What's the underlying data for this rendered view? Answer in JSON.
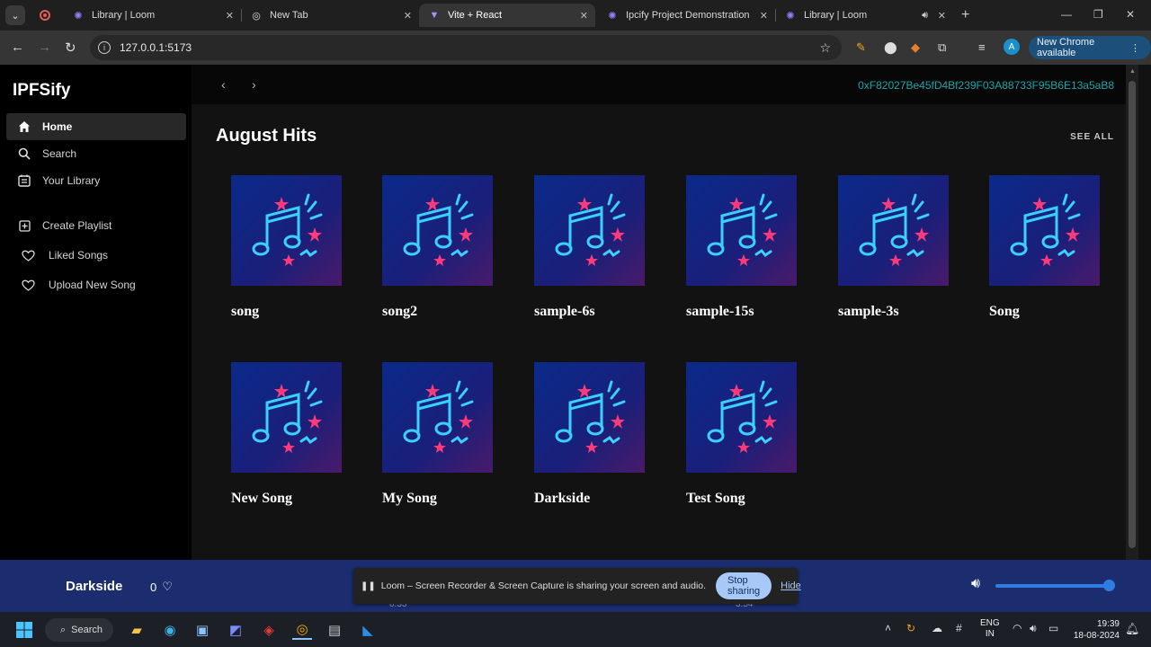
{
  "browser": {
    "tabs": [
      {
        "title": "Library | Loom",
        "icon": "loom-icon"
      },
      {
        "title": "New Tab",
        "icon": "chrome-icon"
      },
      {
        "title": "Vite + React",
        "icon": "vite-icon"
      },
      {
        "title": "Ipcify Project Demonstration",
        "icon": "loom-icon"
      },
      {
        "title": "Library | Loom",
        "icon": "loom-icon"
      }
    ],
    "url": "127.0.0.1:5173",
    "update_label": "New Chrome available",
    "profile_initial": "A"
  },
  "app": {
    "brand": "IPFSify",
    "nav": [
      {
        "label": "Home",
        "icon": "home-icon"
      },
      {
        "label": "Search",
        "icon": "search-icon"
      },
      {
        "label": "Your Library",
        "icon": "library-icon"
      }
    ],
    "actions": [
      {
        "label": "Create Playlist",
        "icon": "plus-square-icon"
      },
      {
        "label": "Liked Songs",
        "icon": "heart-icon"
      },
      {
        "label": "Upload New Song",
        "icon": "heart-icon"
      }
    ],
    "wallet": "0xF82027Be45fD4Bf239F03A88733F95B6E13a5aB8",
    "section_title": "August Hits",
    "see_all": "SEE ALL",
    "songs": [
      {
        "title": "song"
      },
      {
        "title": "song2"
      },
      {
        "title": "sample-6s"
      },
      {
        "title": "sample-15s"
      },
      {
        "title": "sample-3s"
      },
      {
        "title": "Song"
      },
      {
        "title": "New Song"
      },
      {
        "title": "My Song"
      },
      {
        "title": "Darkside"
      },
      {
        "title": "Test Song"
      }
    ]
  },
  "player": {
    "now_playing": "Darkside",
    "likes": "0",
    "time_elapsed": "0:33",
    "time_total": "3:54",
    "volume": 1.0
  },
  "loom": {
    "message": "Loom – Screen Recorder & Screen Capture is sharing your screen and audio.",
    "stop_label": "Stop sharing",
    "hide_label": "Hide"
  },
  "taskbar": {
    "search_label": "Search",
    "lang_line1": "ENG",
    "lang_line2": "IN",
    "time": "19:39",
    "date": "18-08-2024"
  },
  "colors": {
    "accent": "#1aa6a8",
    "player_bg": "#1b2d6e",
    "volume": "#2f7de1"
  }
}
